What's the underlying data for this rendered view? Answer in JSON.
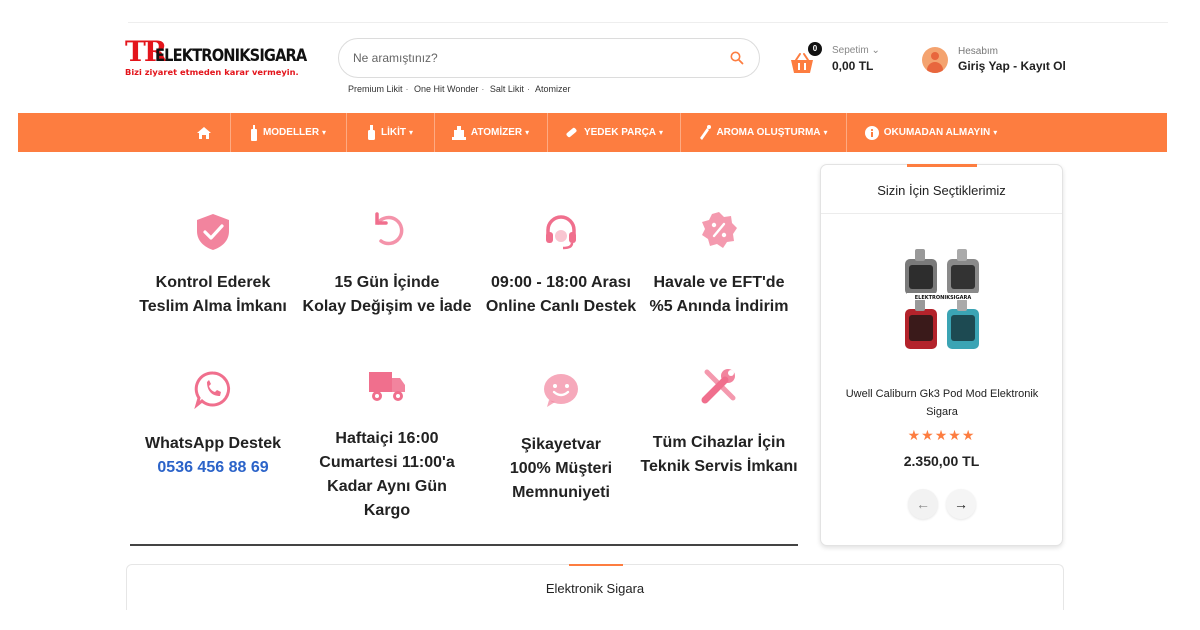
{
  "header": {
    "logo": {
      "tr": "TR",
      "name": "ELEKTRONIKSIGARA",
      "tagline": "Bizi ziyaret etmeden karar vermeyin."
    },
    "search": {
      "placeholder": "Ne aramıştınız?"
    },
    "quick_links": [
      "Premium Likit",
      "One Hit Wonder",
      "Salt Likit",
      "Atomizer"
    ],
    "cart": {
      "badge": "0",
      "label": "Sepetim",
      "total": "0,00 TL"
    },
    "account": {
      "label": "Hesabım",
      "login": "Giriş Yap",
      "register": "Kayıt Ol"
    }
  },
  "nav": {
    "items": [
      {
        "label": "MODELLER",
        "icon": "vape-icon"
      },
      {
        "label": "LİKİT",
        "icon": "bottle-icon"
      },
      {
        "label": "ATOMİZER",
        "icon": "atomizer-icon"
      },
      {
        "label": "YEDEK PARÇA",
        "icon": "coil-icon"
      },
      {
        "label": "AROMA OLUŞTURMA",
        "icon": "dropper-icon"
      },
      {
        "label": "OKUMADAN ALMAYIN",
        "icon": "info-icon"
      }
    ],
    "home_icon": "home-icon"
  },
  "features": [
    {
      "icon": "shield-check-icon",
      "lines": [
        "Kontrol Ederek",
        "Teslim Alma İmkanı"
      ]
    },
    {
      "icon": "return-icon",
      "lines": [
        "15 Gün İçinde",
        "Kolay Değişim ve İade"
      ]
    },
    {
      "icon": "headset-icon",
      "lines": [
        "09:00 - 18:00 Arası",
        "Online Canlı Destek"
      ]
    },
    {
      "icon": "percent-badge-icon",
      "lines": [
        "Havale ve EFT'de",
        "%5 Anında İndirim"
      ]
    },
    {
      "icon": "whatsapp-icon",
      "lines": [
        "WhatsApp Destek"
      ],
      "phone": "0536 456 88 69"
    },
    {
      "icon": "truck-icon",
      "lines": [
        "Haftaiçi 16:00",
        "Cumartesi 11:00'a",
        "Kadar Aynı Gün Kargo"
      ]
    },
    {
      "icon": "smile-icon",
      "lines": [
        "Şikayetvar",
        "100% Müşteri",
        "Memnuniyeti"
      ]
    },
    {
      "icon": "tools-icon",
      "lines": [
        "Tüm Cihazlar İçin",
        "Teknik Servis İmkanı"
      ]
    }
  ],
  "sidebar_card": {
    "title": "Sizin İçin Seçtiklerimiz",
    "product": {
      "name": "Uwell Caliburn Gk3 Pod Mod Elektronik Sigara",
      "rating": 5,
      "stars": "★★★★★",
      "price": "2.350,00 TL",
      "image_label": "ELEKTRONIKSIGARA"
    },
    "prev": "←",
    "next": "→"
  },
  "section": {
    "title": "Elektronik Sigara"
  },
  "colors": {
    "accent": "#fd7d40",
    "brand_red": "#e3141b",
    "pink_icon": "#f06f8d",
    "phone_blue": "#2b63c9"
  }
}
